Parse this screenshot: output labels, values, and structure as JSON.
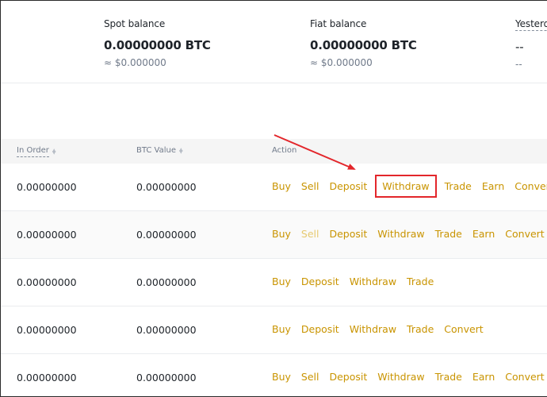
{
  "balances": {
    "spot": {
      "label": "Spot balance",
      "amount": "0.00000000 BTC",
      "fiat": "≈ $0.000000"
    },
    "fiat": {
      "label": "Fiat balance",
      "amount": "0.00000000 BTC",
      "fiat": "≈ $0.000000"
    },
    "yesterday": {
      "label": "Yesterda",
      "amount": "--",
      "fiat": "--"
    }
  },
  "table": {
    "headers": {
      "in_order": "In Order",
      "btc_value": "BTC Value",
      "action": "Action"
    },
    "rows": [
      {
        "in_order": "0.00000000",
        "btc_value": "0.00000000",
        "actions": [
          "Buy",
          "Sell",
          "Deposit",
          "Withdraw",
          "Trade",
          "Earn",
          "Convert"
        ]
      },
      {
        "in_order": "0.00000000",
        "btc_value": "0.00000000",
        "actions": [
          "Buy",
          "Sell",
          "Deposit",
          "Withdraw",
          "Trade",
          "Earn",
          "Convert"
        ]
      },
      {
        "in_order": "0.00000000",
        "btc_value": "0.00000000",
        "actions": [
          "Buy",
          "Deposit",
          "Withdraw",
          "Trade"
        ]
      },
      {
        "in_order": "0.00000000",
        "btc_value": "0.00000000",
        "actions": [
          "Buy",
          "Deposit",
          "Withdraw",
          "Trade",
          "Convert"
        ]
      },
      {
        "in_order": "0.00000000",
        "btc_value": "0.00000000",
        "actions": [
          "Buy",
          "Sell",
          "Deposit",
          "Withdraw",
          "Trade",
          "Earn",
          "Convert"
        ]
      }
    ]
  },
  "colors": {
    "action_link": "#c99400",
    "action_link_disabled": "#e6c970",
    "annotation_red": "#e3262b"
  },
  "annotation": {
    "highlighted_action": "Withdraw",
    "highlighted_row": 0
  }
}
